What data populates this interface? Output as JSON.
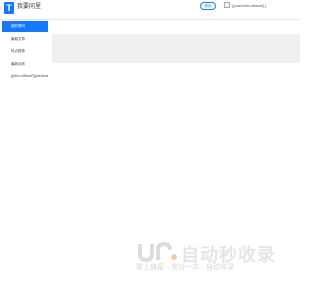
{
  "header": {
    "logo_letter": "T",
    "site_title": "我要问里",
    "link_label": "首页",
    "user_name": "{{userInfo.uName}}"
  },
  "sidebar": {
    "items": [
      {
        "label": "我的提问",
        "active": true
      },
      {
        "label": "最新文章",
        "active": false
      },
      {
        "label": "热点推荐",
        "active": false
      },
      {
        "label": "最新动态",
        "active": false
      },
      {
        "label": "{{item.cfSeedTypeName}}",
        "active": false
      }
    ]
  },
  "watermark": {
    "title": "自动秒收录",
    "slogan": "致上链接→来访一次→自动收录"
  },
  "colors": {
    "accent": "#1677ff",
    "content_bar": "#f0f0f0"
  }
}
